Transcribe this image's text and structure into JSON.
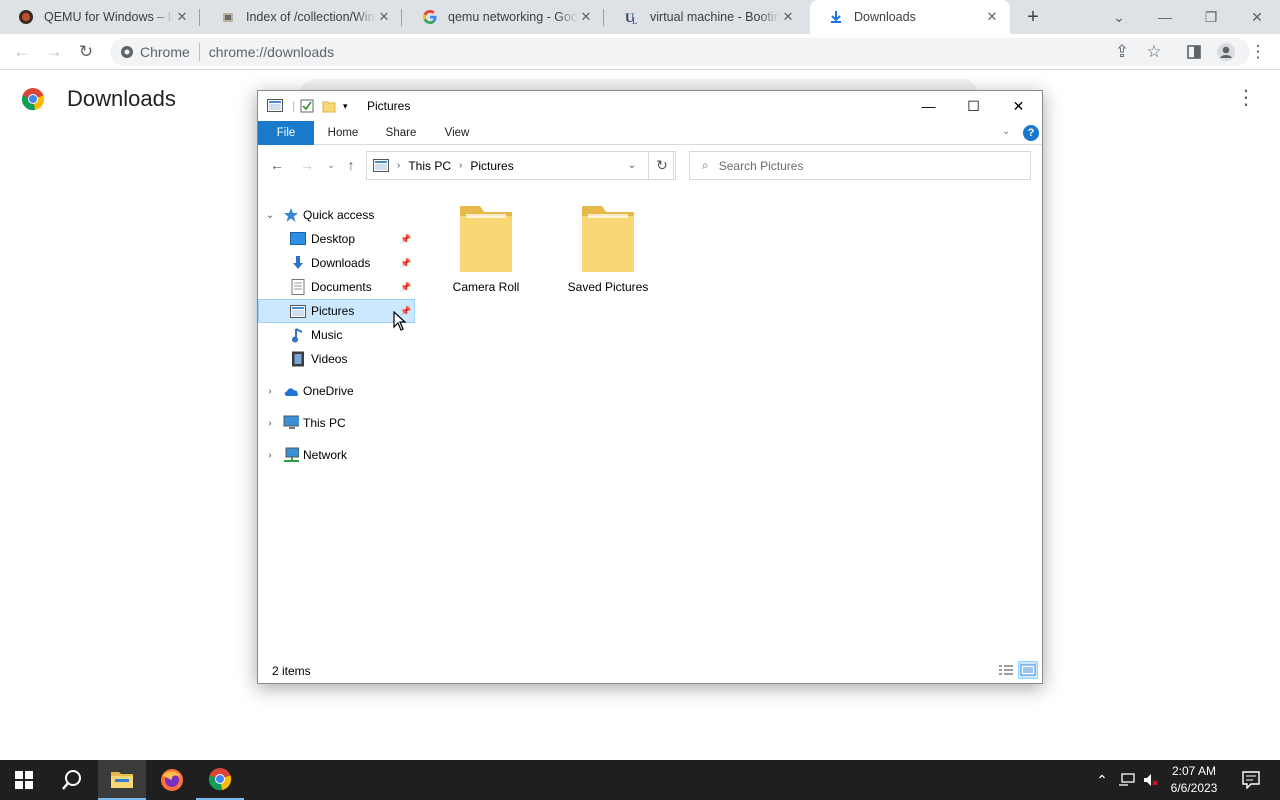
{
  "browser": {
    "tabs": [
      {
        "title": "QEMU for Windows – Inst",
        "favicon": "qemu-icon",
        "active": false
      },
      {
        "title": "Index of /collection/Wind",
        "favicon": "folder-web-icon",
        "active": false
      },
      {
        "title": "qemu networking - Goog",
        "favicon": "google-icon",
        "active": false
      },
      {
        "title": "virtual machine - Booting",
        "favicon": "unix-se-icon",
        "active": false
      },
      {
        "title": "Downloads",
        "favicon": "download-icon",
        "active": true
      }
    ],
    "omnibox": {
      "chip_label": "Chrome",
      "url": "chrome://downloads"
    }
  },
  "downloads_page": {
    "title": "Downloads"
  },
  "explorer": {
    "title": "Pictures",
    "ribbon_tabs": [
      "File",
      "Home",
      "Share",
      "View"
    ],
    "breadcrumb": [
      "This PC",
      "Pictures"
    ],
    "search_placeholder": "Search Pictures",
    "nav_pane": {
      "quick_access": "Quick access",
      "quick_items": [
        {
          "label": "Desktop",
          "icon": "desktop-icon"
        },
        {
          "label": "Downloads",
          "icon": "downloads-icon"
        },
        {
          "label": "Documents",
          "icon": "documents-icon"
        },
        {
          "label": "Pictures",
          "icon": "pictures-icon",
          "selected": true
        },
        {
          "label": "Music",
          "icon": "music-icon"
        },
        {
          "label": "Videos",
          "icon": "videos-icon"
        }
      ],
      "onedrive": "OneDrive",
      "this_pc": "This PC",
      "network": "Network"
    },
    "items": [
      "Camera Roll",
      "Saved Pictures"
    ],
    "status": "2 items"
  },
  "taskbar": {
    "time": "2:07 AM",
    "date": "6/6/2023"
  },
  "colors": {
    "accent": "#1979ca",
    "selection": "#cce8ff",
    "folder": "#f8d775"
  }
}
